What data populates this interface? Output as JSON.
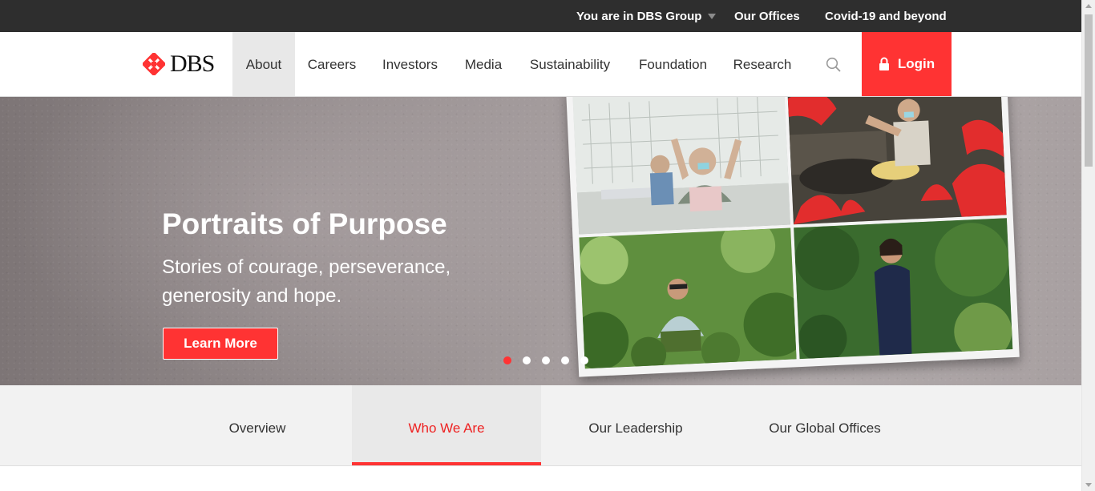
{
  "topbar": {
    "group_label": "You are in DBS Group",
    "offices_label": "Our Offices",
    "covid_label": "Covid-19 and beyond"
  },
  "brand": {
    "logo_text": "DBS",
    "accent_color": "#ff3333"
  },
  "nav": {
    "items": [
      "About",
      "Careers",
      "Investors",
      "Media",
      "Sustainability",
      "Foundation",
      "Research"
    ],
    "active": "About",
    "login_label": "Login"
  },
  "hero": {
    "title": "Portraits of Purpose",
    "subtitle": "Stories of courage, perseverance, generosity and hope.",
    "button_label": "Learn More",
    "slides_total": 5,
    "active_slide": 1
  },
  "subnav": {
    "items": [
      "Overview",
      "Who We Are",
      "Our Leadership",
      "Our Global Offices"
    ],
    "active": "Who We Are"
  }
}
